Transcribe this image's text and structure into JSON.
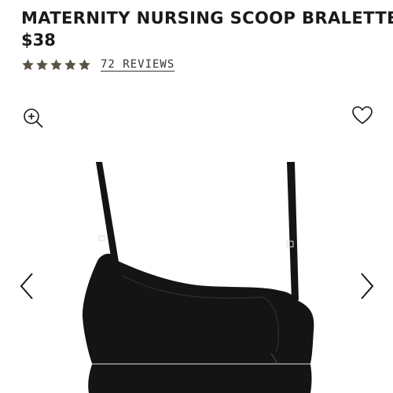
{
  "product": {
    "title": "MATERNITY NURSING SCOOP BRALETTE",
    "price": "$38",
    "rating_stars": 5,
    "rating_color": "#5c5347",
    "reviews_label": "72 REVIEWS"
  },
  "gallery": {
    "icons": {
      "zoom": "zoom-in-icon",
      "favorite": "heart-icon",
      "previous": "chevron-left-icon",
      "next": "chevron-right-icon"
    },
    "image_color": "#141414"
  }
}
